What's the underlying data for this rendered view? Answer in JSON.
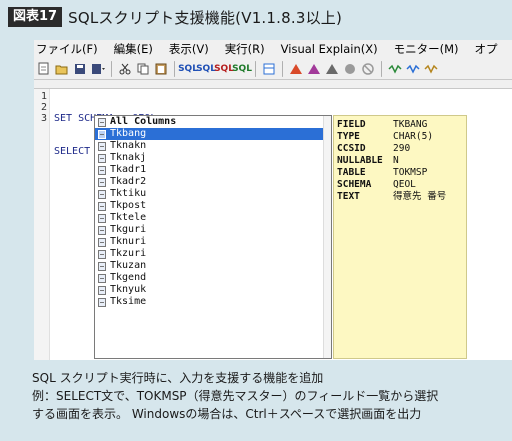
{
  "figure": {
    "label": "図表17",
    "title": "SQLスクリプト支援機能(V1.1.8.3以上)"
  },
  "menubar": [
    "ファイル(F)",
    "編集(E)",
    "表示(V)",
    "実行(R)",
    "Visual Explain(X)",
    "モニター(M)",
    "オプ"
  ],
  "toolbar": {
    "sql_labels": [
      "SQL",
      "SQL",
      "SQL",
      "SQL"
    ]
  },
  "editor": {
    "line_numbers": [
      "1",
      "2",
      "3"
    ],
    "lines": [
      "SET SCHEMA = QEOL;",
      "SELECT  FROM Tokmsp;",
      ""
    ]
  },
  "autocomplete": {
    "items": [
      {
        "label": "All Columns",
        "bold": true,
        "selected": false
      },
      {
        "label": "Tkbang",
        "bold": false,
        "selected": true
      },
      {
        "label": "Tknakn",
        "bold": false,
        "selected": false
      },
      {
        "label": "Tknakj",
        "bold": false,
        "selected": false
      },
      {
        "label": "Tkadr1",
        "bold": false,
        "selected": false
      },
      {
        "label": "Tkadr2",
        "bold": false,
        "selected": false
      },
      {
        "label": "Tktiku",
        "bold": false,
        "selected": false
      },
      {
        "label": "Tkpost",
        "bold": false,
        "selected": false
      },
      {
        "label": "Tktele",
        "bold": false,
        "selected": false
      },
      {
        "label": "Tkguri",
        "bold": false,
        "selected": false
      },
      {
        "label": "Tknuri",
        "bold": false,
        "selected": false
      },
      {
        "label": "Tkzuri",
        "bold": false,
        "selected": false
      },
      {
        "label": "Tkuzan",
        "bold": false,
        "selected": false
      },
      {
        "label": "Tkgend",
        "bold": false,
        "selected": false
      },
      {
        "label": "Tknyuk",
        "bold": false,
        "selected": false
      },
      {
        "label": "Tksime",
        "bold": false,
        "selected": false
      }
    ]
  },
  "info_panel": {
    "rows": [
      {
        "key": "FIELD",
        "value": "TKBANG"
      },
      {
        "key": "TYPE",
        "value": "CHAR(5)"
      },
      {
        "key": "CCSID",
        "value": "290"
      },
      {
        "key": "NULLABLE",
        "value": "N"
      },
      {
        "key": "TABLE",
        "value": "TOKMSP"
      },
      {
        "key": "SCHEMA",
        "value": "QEOL"
      },
      {
        "key": "TEXT",
        "value": "得意先 番号"
      }
    ]
  },
  "caption": {
    "line1": "SQL スクリプト実行時に、入力を支援する機能を追加",
    "line2": "例：SELECT文で、TOKMSP（得意先マスター）のフィールド一覧から選択",
    "line3": "する画面を表示。 Windowsの場合は、Ctrl＋スペースで選択画面を出力"
  },
  "colors": {
    "selection": "#2b6fd6",
    "info_background": "#fdf8c2",
    "code_text": "#1e2a8a",
    "page_background": "#d6e6ec"
  }
}
